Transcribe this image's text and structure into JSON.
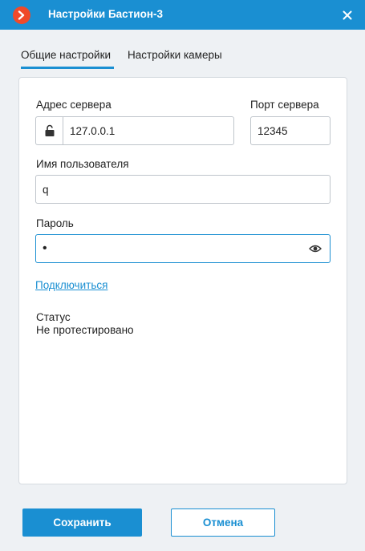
{
  "window": {
    "title": "Настройки Бастион-3",
    "accent_color": "#1a8fd2",
    "logo_color": "#ef4a2a"
  },
  "tabs": [
    {
      "label": "Общие настройки",
      "active": true
    },
    {
      "label": "Настройки камеры",
      "active": false
    }
  ],
  "form": {
    "server_address_label": "Адрес сервера",
    "server_address_value": "127.0.0.1",
    "server_port_label": "Порт сервера",
    "server_port_value": "12345",
    "username_label": "Имя пользователя",
    "username_value": "q",
    "password_label": "Пароль",
    "password_value": "•",
    "connect_link": "Подключиться",
    "status_label": "Статус",
    "status_value": "Не протестировано"
  },
  "footer": {
    "save_label": "Сохранить",
    "cancel_label": "Отмена"
  }
}
